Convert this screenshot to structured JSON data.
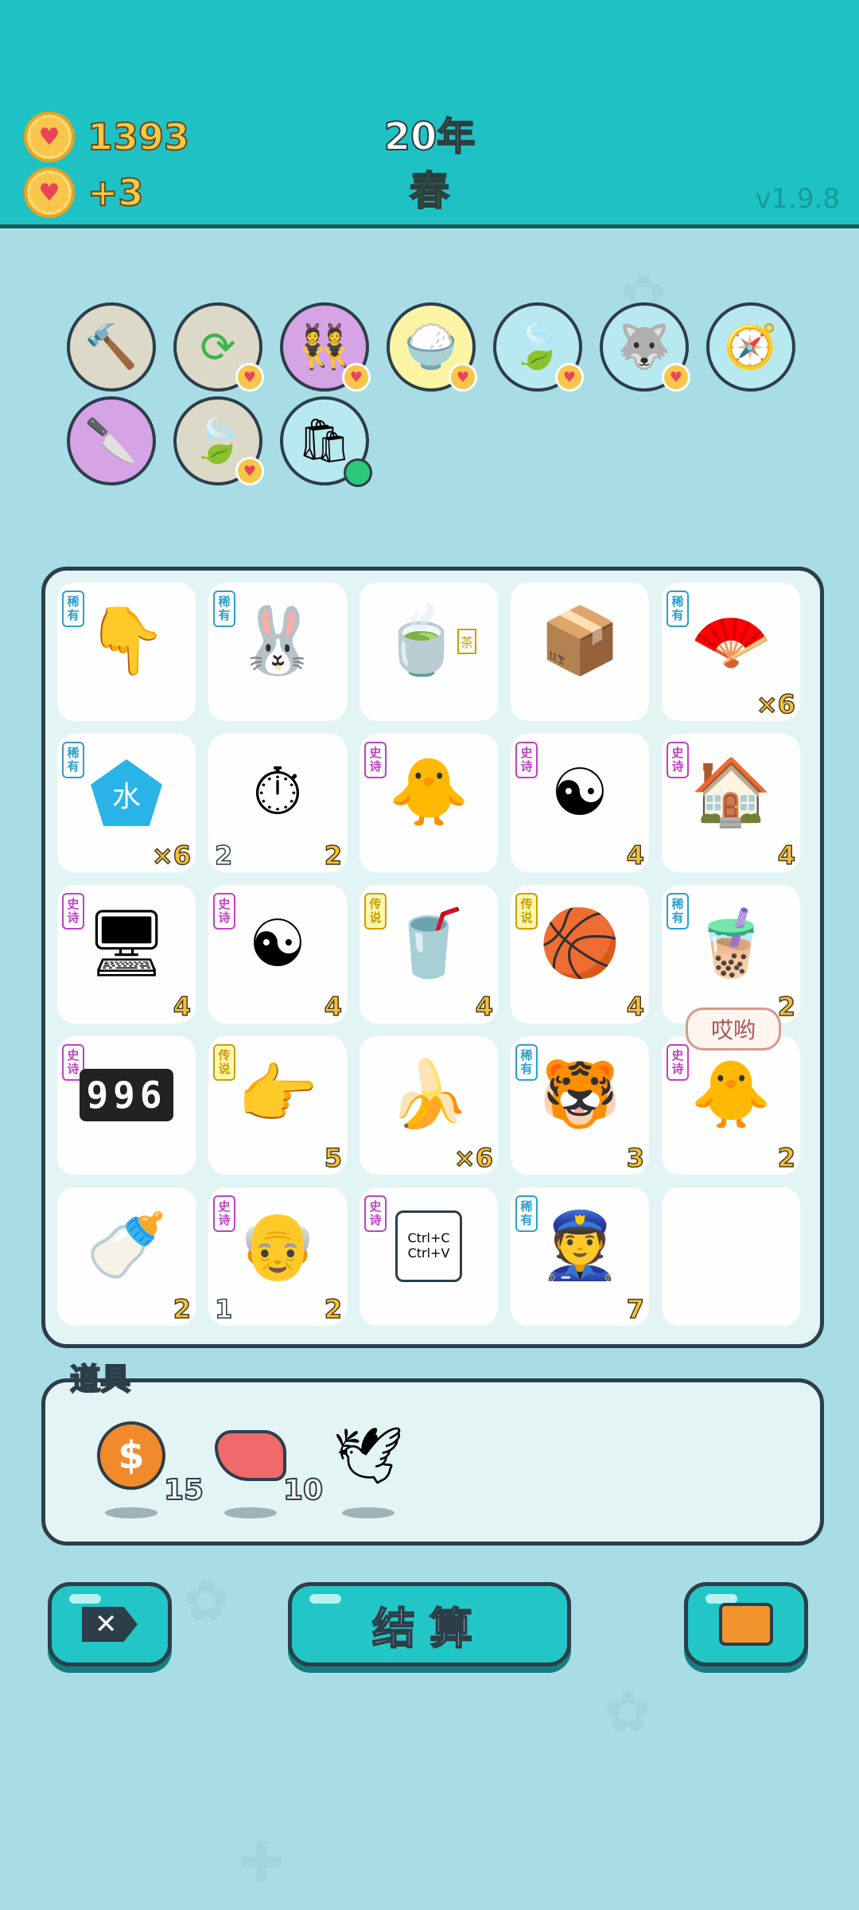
{
  "header": {
    "coins": "1393",
    "coins_delta": "+3",
    "year": "20年",
    "season": "春",
    "version": "v1.9.8"
  },
  "skills": [
    {
      "name": "hammer",
      "bg": "#dcd9c8"
    },
    {
      "name": "refresh",
      "bg": "#dcd9c8"
    },
    {
      "name": "twin-girls",
      "bg": "#d6a3e5"
    },
    {
      "name": "rice-bowl",
      "bg": "#fbf5a3"
    },
    {
      "name": "leaf",
      "bg": "#b9e9f0"
    },
    {
      "name": "husky-dog",
      "bg": "#b9e9f0"
    },
    {
      "name": "compass",
      "bg": "#b9e9f0"
    },
    {
      "name": "cleaver",
      "bg": "#d6a3e5"
    },
    {
      "name": "leaf",
      "bg": "#dcd9c8"
    },
    {
      "name": "sack",
      "bg": "#b9e9f0"
    }
  ],
  "tags": {
    "rare": "稀有",
    "epic": "史诗",
    "legend": "传说"
  },
  "board": [
    {
      "tag": "rare",
      "icon": "finger-down",
      "count": ""
    },
    {
      "tag": "rare",
      "icon": "rabbit",
      "count": ""
    },
    {
      "tag": "",
      "icon": "tea-bag",
      "count": "",
      "icon_label": "茶"
    },
    {
      "tag": "",
      "icon": "parcel-box",
      "count": ""
    },
    {
      "tag": "rare",
      "icon": "fan",
      "count": "×6"
    },
    {
      "tag": "rare",
      "icon": "water-gem",
      "count": "×6",
      "icon_label": "水"
    },
    {
      "tag": "",
      "icon": "stopwatch-card",
      "count": "2",
      "left_count": "2"
    },
    {
      "tag": "epic",
      "icon": "chick-grey-hair",
      "count": ""
    },
    {
      "tag": "epic",
      "icon": "bagua",
      "count": "4"
    },
    {
      "tag": "epic",
      "icon": "rabbit-house",
      "count": "4"
    },
    {
      "tag": "epic",
      "icon": "graphics-card",
      "count": "4"
    },
    {
      "tag": "epic",
      "icon": "bagua",
      "count": "4"
    },
    {
      "tag": "legend",
      "icon": "milk-tea-big",
      "count": "4"
    },
    {
      "tag": "legend",
      "icon": "basketball-eggs",
      "count": "4"
    },
    {
      "tag": "rare",
      "icon": "milk-tea",
      "count": "2"
    },
    {
      "tag": "epic",
      "icon": "996-counter",
      "count": "",
      "icon_label": "996"
    },
    {
      "tag": "legend",
      "icon": "finger-point",
      "count": "5"
    },
    {
      "tag": "",
      "icon": "banana",
      "count": "×6"
    },
    {
      "tag": "rare",
      "icon": "tiger",
      "count": "3"
    },
    {
      "tag": "epic",
      "icon": "chick-grey-hair",
      "count": "2"
    },
    {
      "tag": "",
      "icon": "milk-bottle",
      "count": "2"
    },
    {
      "tag": "epic",
      "icon": "old-man",
      "count": "2",
      "left_count": "1"
    },
    {
      "tag": "epic",
      "icon": "ctrl-c-v",
      "count": "",
      "icon_label": "Ctrl+C Ctrl+V"
    },
    {
      "tag": "rare",
      "icon": "police",
      "count": "7"
    },
    {
      "tag": "",
      "icon": "",
      "count": ""
    }
  ],
  "bubble": "哎哟",
  "items": {
    "title": "道具",
    "list": [
      {
        "icon": "dollar-coin",
        "count": "15"
      },
      {
        "icon": "liver",
        "count": "10"
      },
      {
        "icon": "white-bird",
        "count": ""
      }
    ]
  },
  "buttons": {
    "delete_icon": "delete-icon",
    "settle": "结算",
    "bag_icon": "briefcase-icon"
  }
}
